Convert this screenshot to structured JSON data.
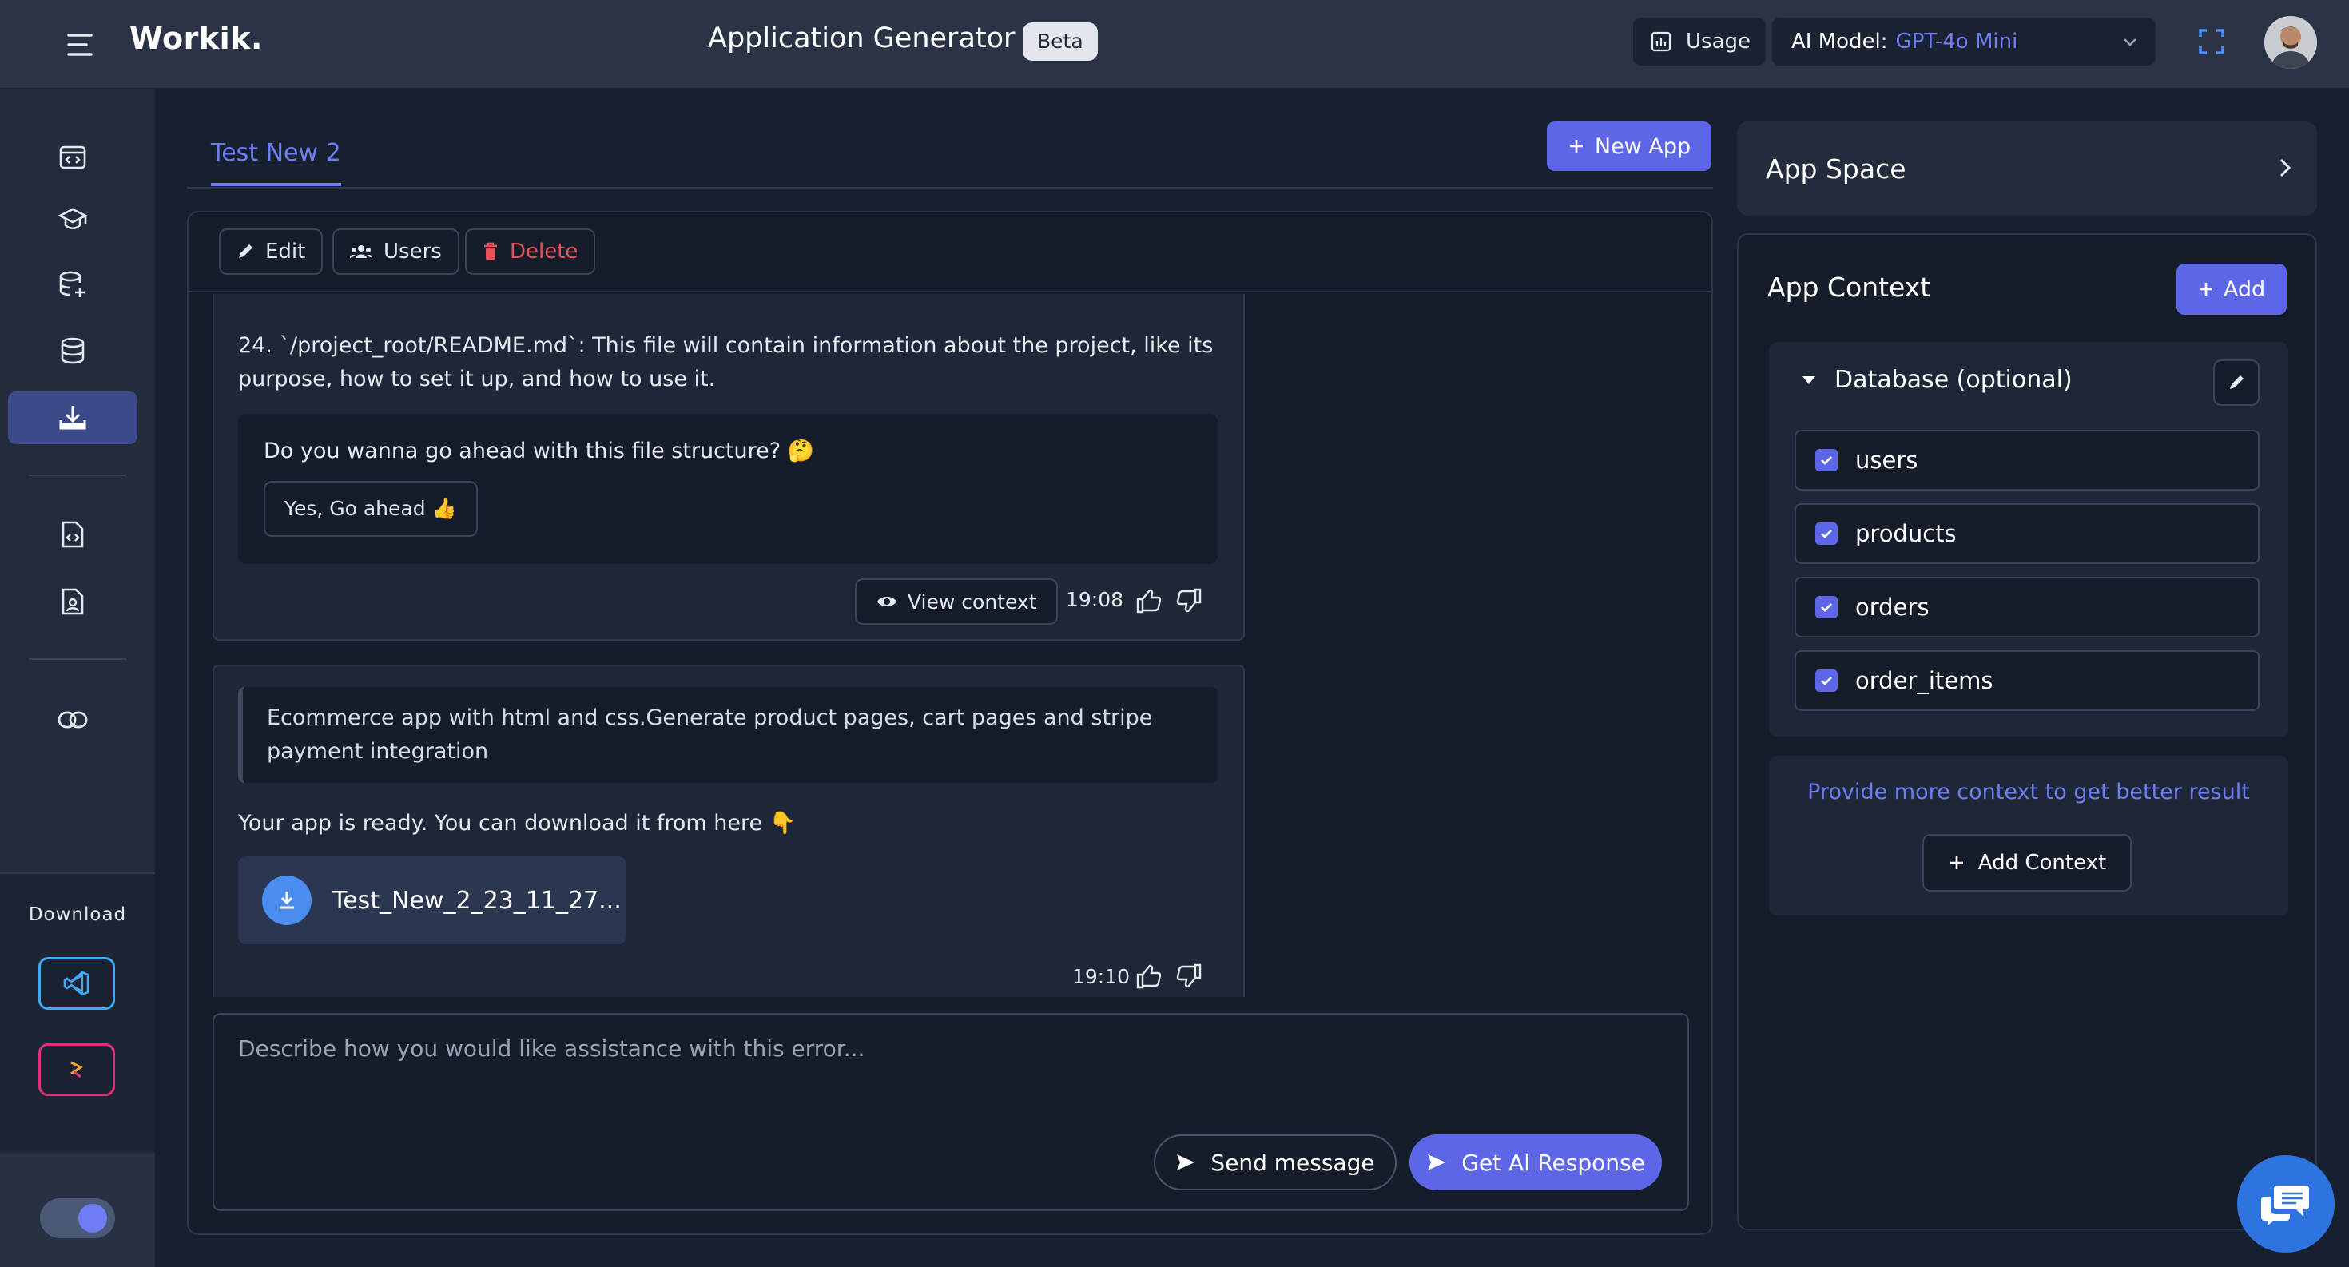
{
  "header": {
    "brand": "Workik.",
    "title": "Application Generator",
    "badge": "Beta",
    "usage_label": "Usage",
    "model_label": "AI Model:",
    "model_value": "GPT-4o Mini"
  },
  "sidebar": {
    "items": [
      {
        "icon": "code-window-icon"
      },
      {
        "icon": "graduation-cap-icon"
      },
      {
        "icon": "database-user-icon"
      },
      {
        "icon": "database-icon"
      },
      {
        "icon": "download-tray-icon",
        "active": true
      },
      {
        "icon": "code-file-icon"
      },
      {
        "icon": "file-user-icon"
      },
      {
        "icon": "link-icon"
      }
    ],
    "download_label": "Download",
    "ide_buttons": [
      "vscode-icon",
      "jetbrains-icon"
    ]
  },
  "main": {
    "tab": "Test New 2",
    "new_app_label": "New App",
    "toolbar": {
      "edit": "Edit",
      "users": "Users",
      "delete": "Delete"
    },
    "message1": {
      "text": "24. `/project_root/README.md`: This file will contain information about the project, like its purpose, how to set it up, and how to use it.",
      "question": "Do you wanna go ahead with this file structure? 🤔",
      "confirm_label": "Yes, Go ahead 👍",
      "view_context_label": "View context",
      "time": "19:08"
    },
    "message2": {
      "prompt": "Ecommerce app with html and css.Generate product pages, cart pages and stripe payment integration",
      "text": "Your app is ready. You can download it from here 👇",
      "file_name": "Test_New_2_23_11_27...",
      "time": "19:10"
    },
    "input": {
      "placeholder": "Describe how you would like assistance with this error...",
      "send_label": "Send message",
      "ai_label": "Get AI Response"
    }
  },
  "right": {
    "app_space_label": "App Space",
    "context_title": "App Context",
    "add_label": "Add",
    "database_label": "Database (optional)",
    "tables": [
      "users",
      "products",
      "orders",
      "order_items"
    ],
    "more_context_text": "Provide more context to get better result",
    "add_context_label": "Add Context"
  },
  "colors": {
    "accent": "#5e66e8",
    "link": "#6f7df4",
    "danger": "#e8525a",
    "background": "#17202f"
  }
}
